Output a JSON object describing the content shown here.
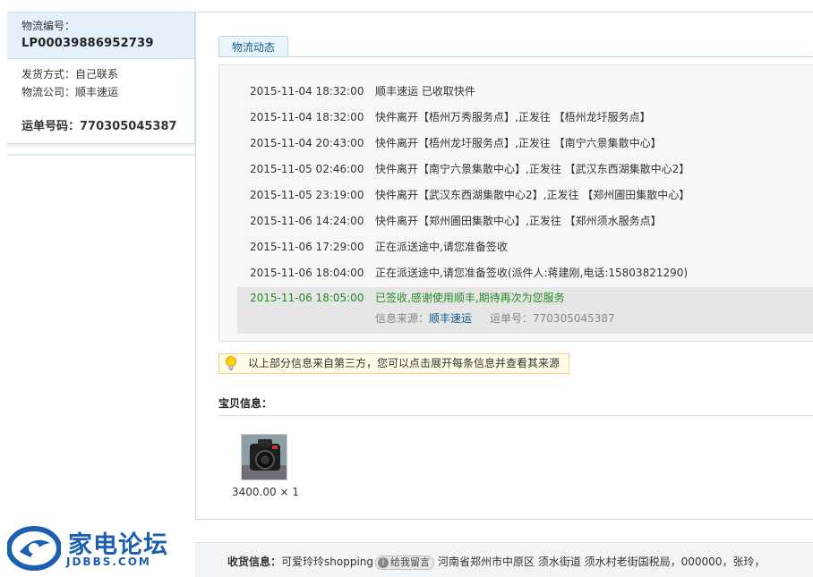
{
  "order": {
    "logistics_no_label": "物流编号：",
    "logistics_no": "LP00039886952739",
    "ship_method": "发货方式：自己联系",
    "carrier": "物流公司：顺丰速运",
    "waybill": "运单号码：770305045387"
  },
  "tabs": [
    {
      "label": "物流动态"
    }
  ],
  "tracking": [
    {
      "time": "2015-11-04 18:32:00",
      "text": "顺丰速运 已收取快件"
    },
    {
      "time": "2015-11-04 18:32:00",
      "text": "快件离开【梧州万秀服务点】,正发往 【梧州龙圩服务点】"
    },
    {
      "time": "2015-11-04 20:43:00",
      "text": "快件离开【梧州龙圩服务点】,正发往 【南宁六景集散中心】"
    },
    {
      "time": "2015-11-05 02:46:00",
      "text": "快件离开【南宁六景集散中心】,正发往 【武汉东西湖集散中心2】"
    },
    {
      "time": "2015-11-05 23:19:00",
      "text": "快件离开【武汉东西湖集散中心2】,正发往 【郑州圃田集散中心】"
    },
    {
      "time": "2015-11-06 14:24:00",
      "text": "快件离开【郑州圃田集散中心】,正发往 【郑州须水服务点】"
    },
    {
      "time": "2015-11-06 17:29:00",
      "text": "正在派送途中,请您准备签收"
    },
    {
      "time": "2015-11-06 18:04:00",
      "text": "正在派送途中,请您准备签收(派件人:蒋建刚,电话:15803821290)"
    }
  ],
  "last": {
    "time": "2015-11-06 18:05:00",
    "text": "已签收,感谢使用顺丰,期待再次为您服务",
    "source_label": "信息来源：",
    "source": "顺丰速运",
    "waybill": "运单号：770305045387"
  },
  "tip": "以上部分信息来自第三方，您可以点击展开每条信息并查看其来源",
  "goods": {
    "title": "宝贝信息：",
    "price": "3400.00 × 1"
  },
  "logo": {
    "text": "家电论坛",
    "sub": "JDBBS.COM"
  },
  "shipping": {
    "label": "收货信息：",
    "buyer": "可爱玲玲shopping",
    "msg_btn": "给我留言",
    "address": "河南省郑州市中原区 须水街道 须水村老街国税局，000000，张玲，"
  },
  "colors": {
    "accent": "#0b5e8c",
    "success": "#228b22",
    "logo": "#1d5fb0"
  }
}
